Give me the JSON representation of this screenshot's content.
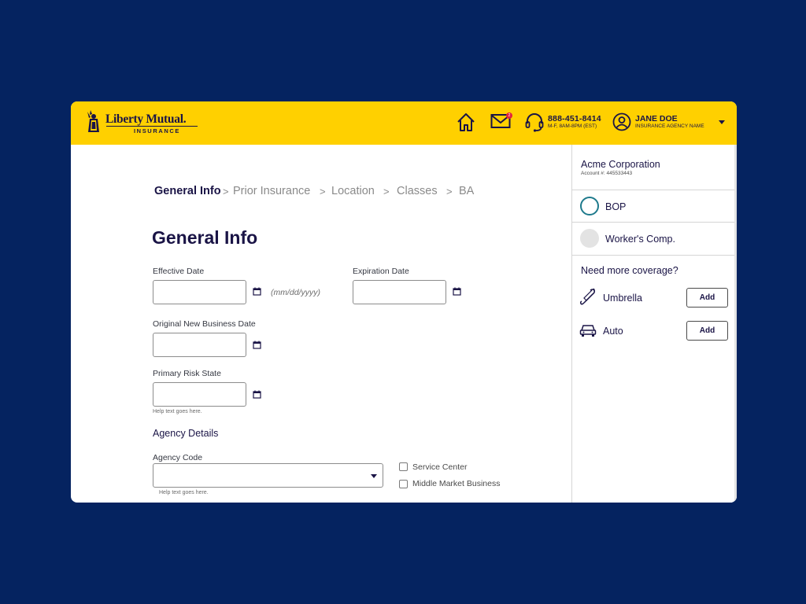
{
  "header": {
    "logo_name": "Liberty Mutual.",
    "logo_sub": "INSURANCE",
    "mail_badge": "2",
    "phone_number": "888-451-8414",
    "phone_hours": "M-F, 8AM-8PM (EST)",
    "user_name": "JANE DOE",
    "user_agency": "INSURANCE AGENCY NAME",
    "icons": [
      "statue-of-liberty-icon",
      "home-icon",
      "mail-icon",
      "headset-icon",
      "user-icon",
      "caret-down-icon"
    ],
    "colors": {
      "bar": "#ffd000",
      "text": "#1a1446"
    }
  },
  "breadcrumb": {
    "items": [
      "General Info",
      "Prior Insurance",
      "Location",
      "Classes",
      "BA"
    ],
    "separator": ">"
  },
  "form": {
    "title": "General Info",
    "effective_date_label": "Effective Date",
    "date_format_hint": "(mm/dd/yyyy)",
    "expiration_date_label": "Expiration Date",
    "original_date_label": "Original New Business Date",
    "primary_risk_label": "Primary Risk State",
    "help_text": "Help text goes here.",
    "agency_section_title": "Agency Details",
    "agency_code_label": "Agency Code",
    "agency_help_text": "Help text goes here.",
    "service_center_label": "Service Center",
    "middle_market_label": "Middle Market Business"
  },
  "sidebar": {
    "account_name": "Acme Corporation",
    "account_number": "Account #: 445533443",
    "coverages": [
      {
        "label": "BOP",
        "selected": true
      },
      {
        "label": "Worker's Comp.",
        "selected": false
      }
    ],
    "more_title": "Need more coverage?",
    "addons": [
      {
        "label": "Umbrella",
        "button": "Add",
        "icon": "umbrella-icon"
      },
      {
        "label": "Auto",
        "button": "Add",
        "icon": "car-icon"
      }
    ],
    "colors": {
      "selected_ring": "#1e7a8c",
      "unselected_fill": "#e3e3e3"
    }
  },
  "page": {
    "background": "#052360"
  }
}
